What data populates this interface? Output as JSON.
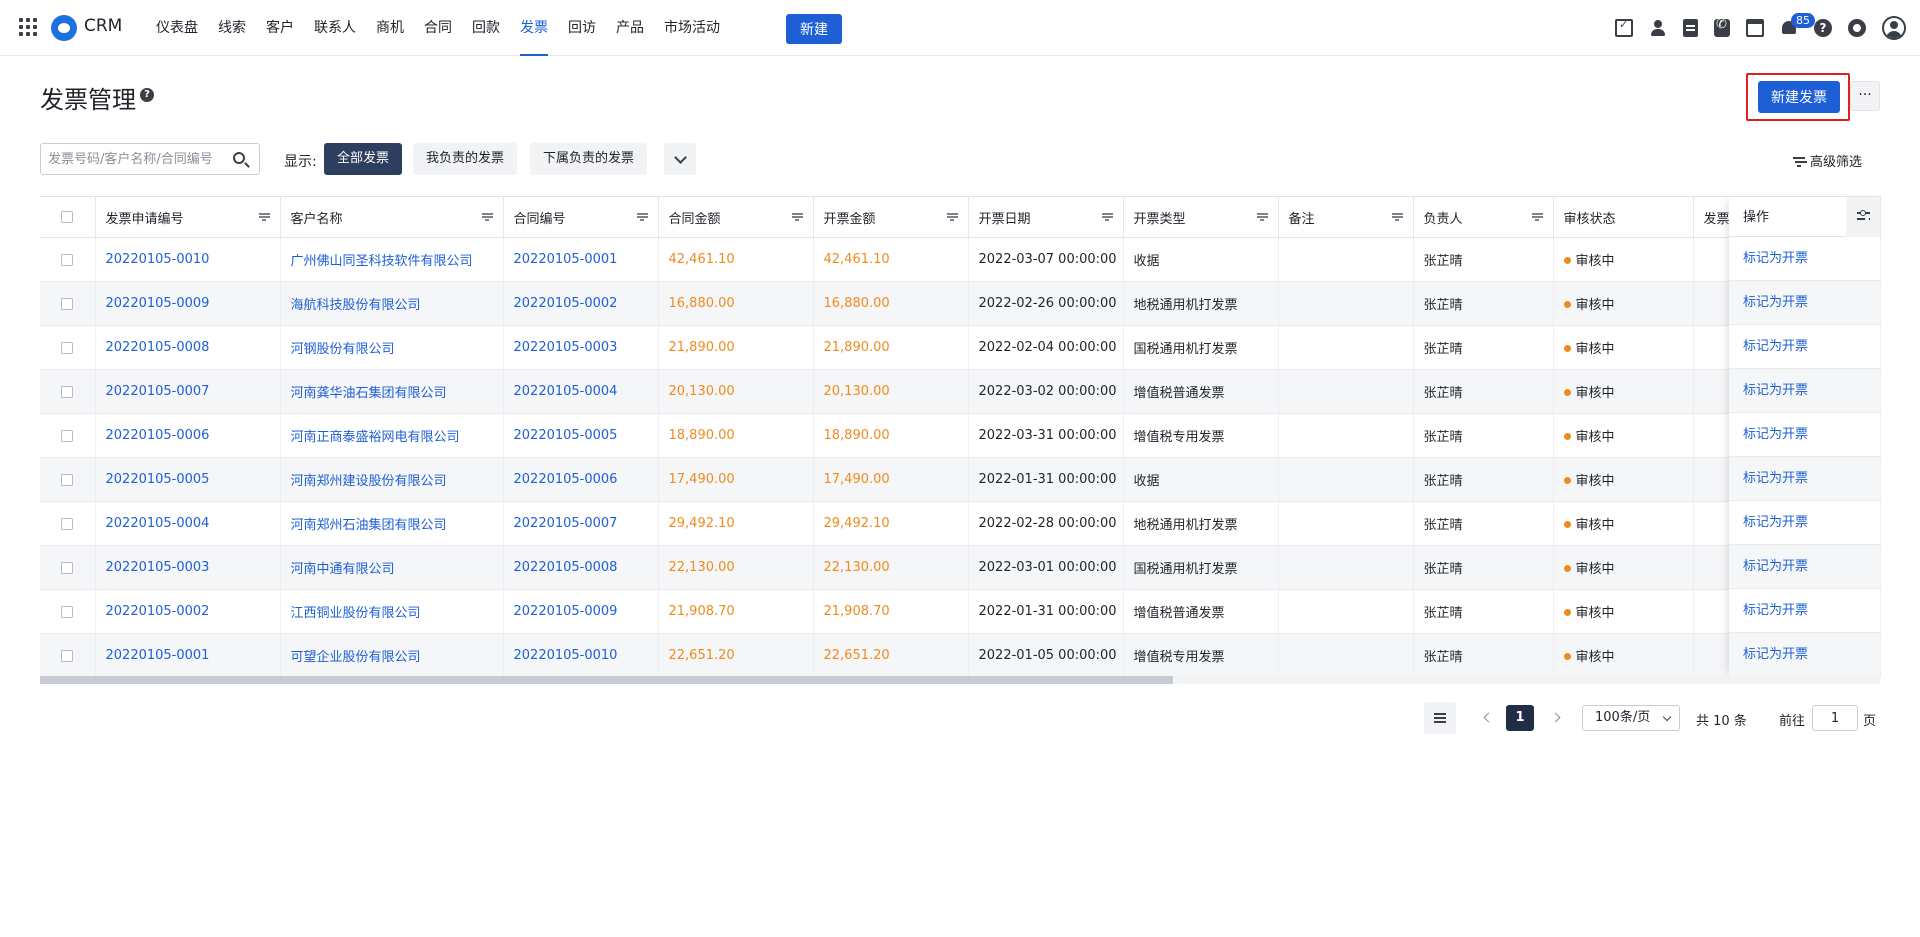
{
  "topbar": {
    "brand": "CRM",
    "nav": [
      "仪表盘",
      "线索",
      "客户",
      "联系人",
      "商机",
      "合同",
      "回款",
      "发票",
      "回访",
      "产品",
      "市场活动"
    ],
    "active_nav": "发票",
    "new_button": "新建",
    "notification_count": "85",
    "icons": [
      "task-icon",
      "contact-icon",
      "document-icon",
      "phone-icon",
      "calendar-icon",
      "bell-icon",
      "help-icon",
      "gear-icon",
      "avatar-icon"
    ],
    "accent_color": "#1e5fd6"
  },
  "page": {
    "title": "发票管理",
    "create_button": "新建发票",
    "more_button": "···"
  },
  "filters": {
    "search_placeholder": "发票号码/客户名称/合同编号",
    "show_label": "显示:",
    "segments": [
      "全部发票",
      "我负责的发票",
      "下属负责的发票"
    ],
    "active_segment": "全部发票",
    "advanced": "高级筛选"
  },
  "table": {
    "columns": [
      "发票申请编号",
      "客户名称",
      "合同编号",
      "合同金额",
      "开票金额",
      "开票日期",
      "开票类型",
      "备注",
      "负责人",
      "审核状态",
      "发票"
    ],
    "action_header": "操作",
    "rows": [
      {
        "id": "20220105-0010",
        "customer": "广州佛山同圣科技软件有限公司",
        "contract": "20220105-0001",
        "contract_amount": "42,461.10",
        "invoice_amount": "42,461.10",
        "date": "2022-03-07 00:00:00",
        "type": "收据",
        "note": "",
        "owner": "张芷晴",
        "status": "审核中",
        "action": "标记为开票"
      },
      {
        "id": "20220105-0009",
        "customer": "海航科技股份有限公司",
        "contract": "20220105-0002",
        "contract_amount": "16,880.00",
        "invoice_amount": "16,880.00",
        "date": "2022-02-26 00:00:00",
        "type": "地税通用机打发票",
        "note": "",
        "owner": "张芷晴",
        "status": "审核中",
        "action": "标记为开票"
      },
      {
        "id": "20220105-0008",
        "customer": "河钢股份有限公司",
        "contract": "20220105-0003",
        "contract_amount": "21,890.00",
        "invoice_amount": "21,890.00",
        "date": "2022-02-04 00:00:00",
        "type": "国税通用机打发票",
        "note": "",
        "owner": "张芷晴",
        "status": "审核中",
        "action": "标记为开票"
      },
      {
        "id": "20220105-0007",
        "customer": "河南龚华油石集团有限公司",
        "contract": "20220105-0004",
        "contract_amount": "20,130.00",
        "invoice_amount": "20,130.00",
        "date": "2022-03-02 00:00:00",
        "type": "增值税普通发票",
        "note": "",
        "owner": "张芷晴",
        "status": "审核中",
        "action": "标记为开票"
      },
      {
        "id": "20220105-0006",
        "customer": "河南正商泰盛裕网电有限公司",
        "contract": "20220105-0005",
        "contract_amount": "18,890.00",
        "invoice_amount": "18,890.00",
        "date": "2022-03-31 00:00:00",
        "type": "增值税专用发票",
        "note": "",
        "owner": "张芷晴",
        "status": "审核中",
        "action": "标记为开票"
      },
      {
        "id": "20220105-0005",
        "customer": "河南郑州建设股份有限公司",
        "contract": "20220105-0006",
        "contract_amount": "17,490.00",
        "invoice_amount": "17,490.00",
        "date": "2022-01-31 00:00:00",
        "type": "收据",
        "note": "",
        "owner": "张芷晴",
        "status": "审核中",
        "action": "标记为开票"
      },
      {
        "id": "20220105-0004",
        "customer": "河南郑州石油集团有限公司",
        "contract": "20220105-0007",
        "contract_amount": "29,492.10",
        "invoice_amount": "29,492.10",
        "date": "2022-02-28 00:00:00",
        "type": "地税通用机打发票",
        "note": "",
        "owner": "张芷晴",
        "status": "审核中",
        "action": "标记为开票"
      },
      {
        "id": "20220105-0003",
        "customer": "河南中通有限公司",
        "contract": "20220105-0008",
        "contract_amount": "22,130.00",
        "invoice_amount": "22,130.00",
        "date": "2022-03-01 00:00:00",
        "type": "国税通用机打发票",
        "note": "",
        "owner": "张芷晴",
        "status": "审核中",
        "action": "标记为开票"
      },
      {
        "id": "20220105-0002",
        "customer": "江西铜业股份有限公司",
        "contract": "20220105-0009",
        "contract_amount": "21,908.70",
        "invoice_amount": "21,908.70",
        "date": "2022-01-31 00:00:00",
        "type": "增值税普通发票",
        "note": "",
        "owner": "张芷晴",
        "status": "审核中",
        "action": "标记为开票"
      },
      {
        "id": "20220105-0001",
        "customer": "可望企业股份有限公司",
        "contract": "20220105-0010",
        "contract_amount": "22,651.20",
        "invoice_amount": "22,651.20",
        "date": "2022-01-05 00:00:00",
        "type": "增值税专用发票",
        "note": "",
        "owner": "张芷晴",
        "status": "审核中",
        "action": "标记为开票"
      }
    ],
    "amount_color": "#f08a1e",
    "status_color": "#f08a1e"
  },
  "pagination": {
    "current_page": "1",
    "page_size": "100条/页",
    "total": "共 10 条",
    "goto_label": "前往",
    "goto_value": "1",
    "page_suffix": "页"
  }
}
